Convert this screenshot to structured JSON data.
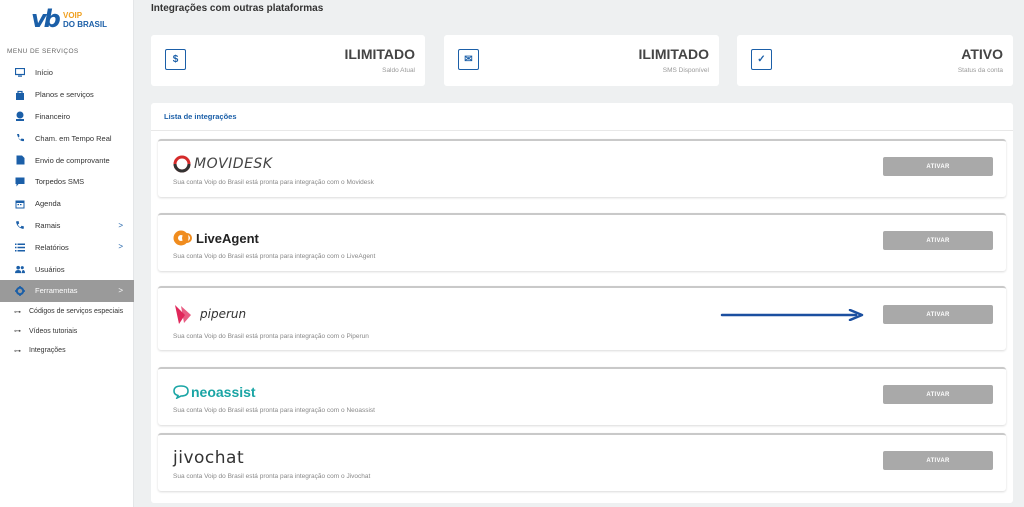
{
  "logo": {
    "mark": "vb",
    "line1": "VOIP",
    "line2": "DO BRASIL"
  },
  "sidebar": {
    "menu_title": "MENU DE SERVIÇOS",
    "items": [
      {
        "label": "Início",
        "icon": "monitor-icon"
      },
      {
        "label": "Planos e serviços",
        "icon": "bag-icon"
      },
      {
        "label": "Financeiro",
        "icon": "money-icon"
      },
      {
        "label": "Cham. em Tempo Real",
        "icon": "phone-call-icon"
      },
      {
        "label": "Envio de comprovante",
        "icon": "file-icon"
      },
      {
        "label": "Torpedos SMS",
        "icon": "chat-icon"
      },
      {
        "label": "Agenda",
        "icon": "calendar-icon"
      },
      {
        "label": "Ramais",
        "icon": "phone-icon",
        "chevron": ">"
      },
      {
        "label": "Relatórios",
        "icon": "list-icon",
        "chevron": ">"
      },
      {
        "label": "Usuários",
        "icon": "users-icon"
      },
      {
        "label": "Ferramentas",
        "icon": "gear-icon",
        "chevron": ">"
      }
    ],
    "subitems": [
      {
        "label": "Códigos de serviços especiais",
        "icon": "key-icon"
      },
      {
        "label": "Vídeos tutoriais",
        "icon": "key-icon"
      },
      {
        "label": "Integrações",
        "icon": "key-icon"
      }
    ]
  },
  "page_title": "Integrações com outras plataformas",
  "cards": [
    {
      "icon_glyph": "$",
      "value": "ILIMITADO",
      "label": "Saldo Atual"
    },
    {
      "icon_glyph": "✉",
      "value": "ILIMITADO",
      "label": "SMS Disponível"
    },
    {
      "icon_glyph": "✓",
      "value": "ATIVO",
      "label": "Status da conta"
    }
  ],
  "panel": {
    "title": "Lista de integrações",
    "integrations": [
      {
        "brand": "MOVIDESK",
        "description": "Sua conta Voip do Brasil está pronta para integração com o Movidesk",
        "button": "ATIVAR"
      },
      {
        "brand": "LiveAgent",
        "description": "Sua conta Voip do Brasil está pronta para integração com o LiveAgent",
        "button": "ATIVAR"
      },
      {
        "brand": "piperun",
        "description": "Sua conta Voip do Brasil está pronta para integração com o Piperun",
        "button": "ATIVAR"
      },
      {
        "brand": "neoassist",
        "description": "Sua conta Voip do Brasil está pronta para integração com o Neoassist",
        "button": "ATIVAR"
      },
      {
        "brand": "jivochat",
        "description": "Sua conta Voip do Brasil está pronta para integração com o Jivochat",
        "button": "ATIVAR"
      }
    ]
  },
  "colors": {
    "accent": "#1b5fa8",
    "active_menu": "#9a9a9a",
    "button": "#a9a9a9"
  }
}
